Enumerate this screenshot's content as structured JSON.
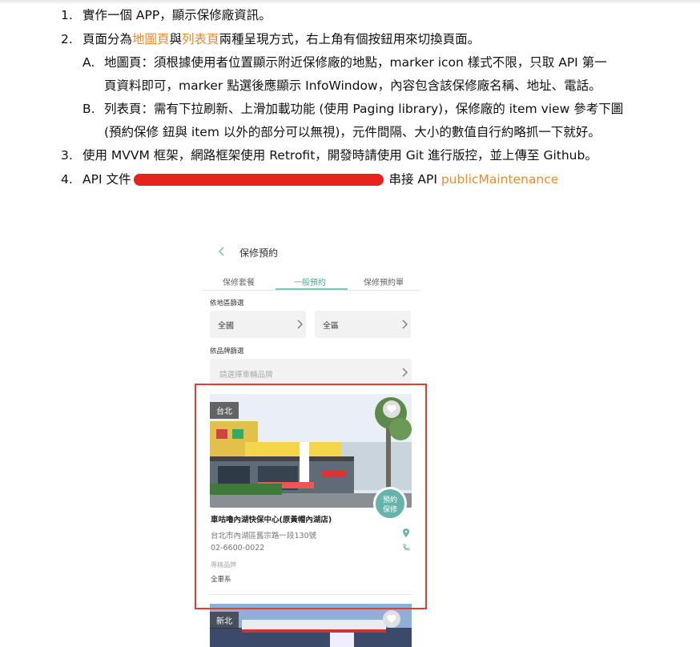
{
  "document": {
    "items": [
      {
        "number": "1.",
        "text": "實作一個 APP，顯示保修廠資訊。"
      },
      {
        "number": "2.",
        "pre": "頁面分為",
        "map_link": "地圖頁",
        "mid": "與",
        "list_link": "列表頁",
        "post": "兩種呈現方式，右上角有個按鈕用來切換頁面。",
        "sub": [
          {
            "letter": "A.",
            "line1": "地圖頁：須根據使用者位置顯示附近保修廠的地點，marker icon 樣式不限，只取 API 第一",
            "line2": "頁資料即可，marker 點選後應顯示 InfoWindow，內容包含該保修廠名稱、地址、電話。"
          },
          {
            "letter": "B.",
            "line1": "列表頁：需有下拉刷新、上滑加載功能 (使用 Paging library)，保修廠的 item view 參考下圖",
            "line2": "(預約保修 鈕與 item 以外的部分可以無視)，元件間隔、大小的數值自行約略抓一下就好。"
          }
        ]
      },
      {
        "number": "3.",
        "text": "使用 MVVM 框架，網路框架使用 Retrofit，開發時請使用 Git 進行版控，並上傳至 Github。"
      },
      {
        "number": "4.",
        "pre": "API 文件",
        "mid": "串接 API",
        "api_link": "publicMaintenance"
      }
    ],
    "accent_color": "#f0892a",
    "redaction_color": "#e8231e"
  },
  "phone": {
    "title": "保修預約",
    "tabs": [
      {
        "label": "保修套餐",
        "active": false
      },
      {
        "label": "一般預約",
        "active": true
      },
      {
        "label": "保修預約單",
        "active": false
      }
    ],
    "region_filter": {
      "label": "依地區篩選",
      "city": "全國",
      "district": "全區"
    },
    "brand_filter": {
      "label": "依品牌篩選",
      "placeholder": "請選擇車輛品牌"
    },
    "cards": [
      {
        "region": "台北",
        "book_button": [
          "預約",
          "保修"
        ],
        "name": "車咕嚕內湖快保中心(原黃帽內湖店)",
        "address": "台北市內湖區舊宗路一段130號",
        "phone": "02-6600-0022",
        "brand_label": "專精品牌",
        "brand": "全車系"
      },
      {
        "region": "新北"
      }
    ],
    "accent_color": "#66b3ab",
    "highlight_color": "#e43d2f"
  }
}
